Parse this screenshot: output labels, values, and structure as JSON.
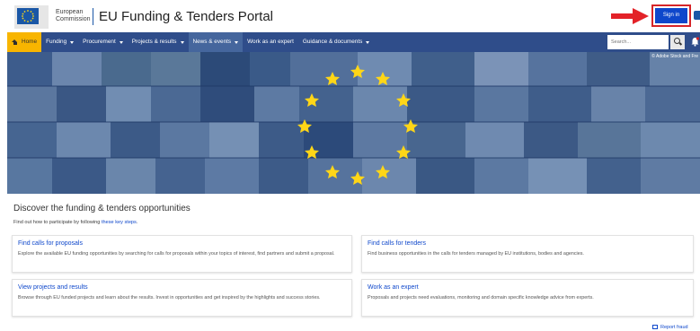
{
  "header": {
    "commission_line1": "European",
    "commission_line2": "Commission",
    "portal_title": "EU Funding & Tenders Portal",
    "sign_in_label": "Sign in"
  },
  "nav": {
    "items": [
      {
        "label": "Home",
        "kind": "home"
      },
      {
        "label": "Funding",
        "dropdown": true
      },
      {
        "label": "Procurement",
        "dropdown": true
      },
      {
        "label": "Projects & results",
        "dropdown": true
      },
      {
        "label": "News & events",
        "dropdown": true,
        "active": true
      },
      {
        "label": "Work as an expert",
        "dropdown": false
      },
      {
        "label": "Guidance & documents",
        "dropdown": true
      }
    ],
    "search_placeholder": "Search..."
  },
  "hero": {
    "credit": "© Adobe Stock and Fre"
  },
  "discover": {
    "title": "Discover the funding & tenders opportunities",
    "subtitle_prefix": "Find out how to participate by following",
    "subtitle_link": "these key steps",
    "subtitle_suffix": "."
  },
  "cards": [
    {
      "title": "Find calls for proposals",
      "desc": "Explore the available EU funding opportunities by searching for calls for proposals within your topics of interest, find partners and submit a proposal."
    },
    {
      "title": "Find calls for tenders",
      "desc": "Find business opportunities in the calls for tenders managed by EU institutions, bodies and agencies."
    },
    {
      "title": "View projects and results",
      "desc": "Browse through EU funded projects and learn about the results. Invest in opportunities and get inspired by the highlights and success stories."
    },
    {
      "title": "Work as an expert",
      "desc": "Proposals and projects need evaluations, monitoring and domain specific knowledge advice from experts."
    }
  ],
  "footer": {
    "report_label": "Report fraud"
  },
  "colors": {
    "nav_bg": "#2f4d8a",
    "home_bg": "#f8b500",
    "link": "#0e47cb",
    "accent_red": "#d62428",
    "star": "#ffd617"
  }
}
